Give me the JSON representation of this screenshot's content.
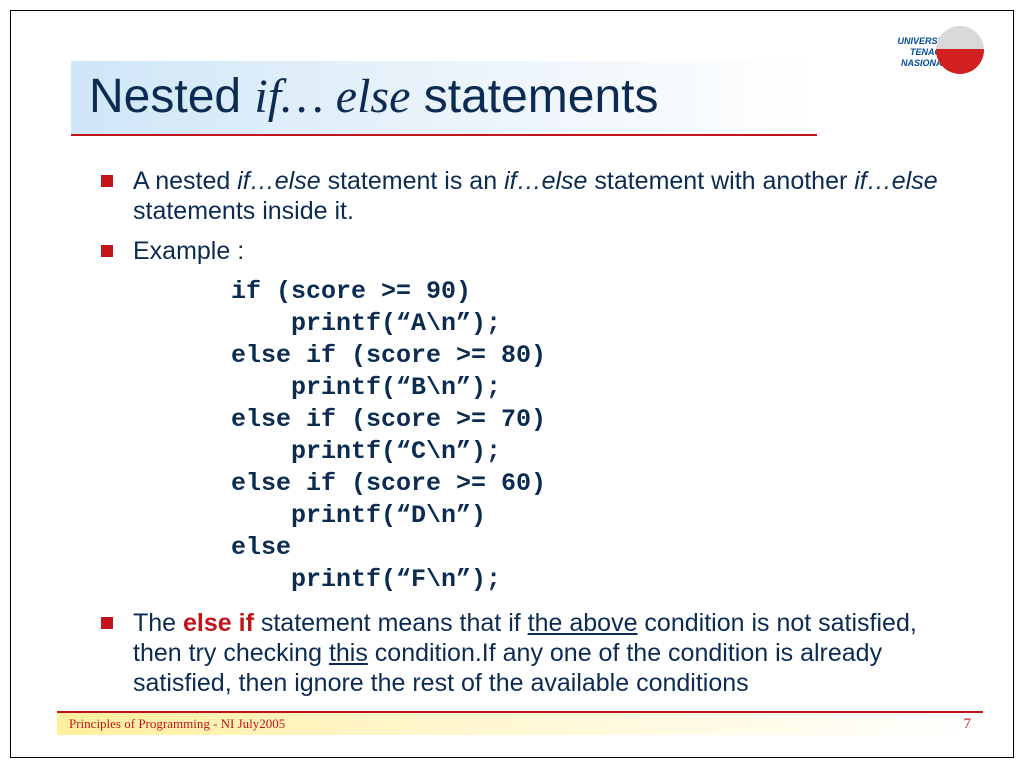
{
  "logo": {
    "line1": "UNIVERSITI",
    "line2": "TENAGA",
    "line3": "NASIONAL"
  },
  "title": {
    "part1": "Nested ",
    "part2": "if… else",
    "part3": " statements"
  },
  "bullets": {
    "b1": {
      "pre": "A nested ",
      "it1": "if…else",
      "mid1": " statement is an ",
      "it2": "if…else",
      "mid2": " statement with another  ",
      "it3": "if…else",
      "post": " statements inside it."
    },
    "b2": "Example :",
    "b3": {
      "pre": "The ",
      "red": "else if",
      "mid1": " statement means that if ",
      "ul1": "the above",
      "mid2": " condition is not satisfied, then try checking ",
      "ul2": "this",
      "post": " condition.If any one of the condition is already satisfied, then ignore the rest of the available conditions"
    }
  },
  "code": "if (score >= 90)\n    printf(“A\\n”);\nelse if (score >= 80)\n    printf(“B\\n”);\nelse if (score >= 70)\n    printf(“C\\n”);\nelse if (score >= 60)\n    printf(“D\\n”)\nelse\n    printf(“F\\n”);",
  "footer": {
    "text": "Principles of Programming - NI July2005",
    "page": "7"
  }
}
